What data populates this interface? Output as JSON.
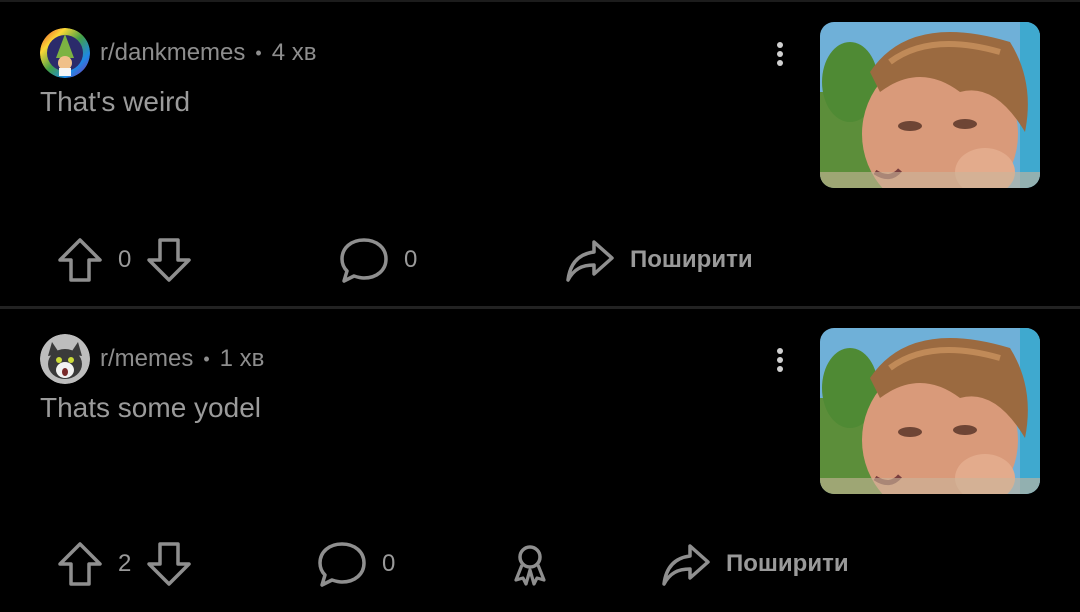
{
  "posts": [
    {
      "subreddit": "r/dankmemes",
      "separator": "•",
      "time": "4 хв",
      "title": "That's weird",
      "score": "0",
      "comments": "0",
      "share_label": "Поширити",
      "avatar_icon": "dankmemes-avatar-icon",
      "has_award_button": false
    },
    {
      "subreddit": "r/memes",
      "separator": "•",
      "time": "1 хв",
      "title": "Thats some yodel",
      "score": "2",
      "comments": "0",
      "share_label": "Поширити",
      "avatar_icon": "memes-cat-avatar-icon",
      "has_award_button": true
    }
  ],
  "colors": {
    "background": "#000000",
    "text": "#9a9a9a",
    "icon": "#8f8f8f"
  }
}
